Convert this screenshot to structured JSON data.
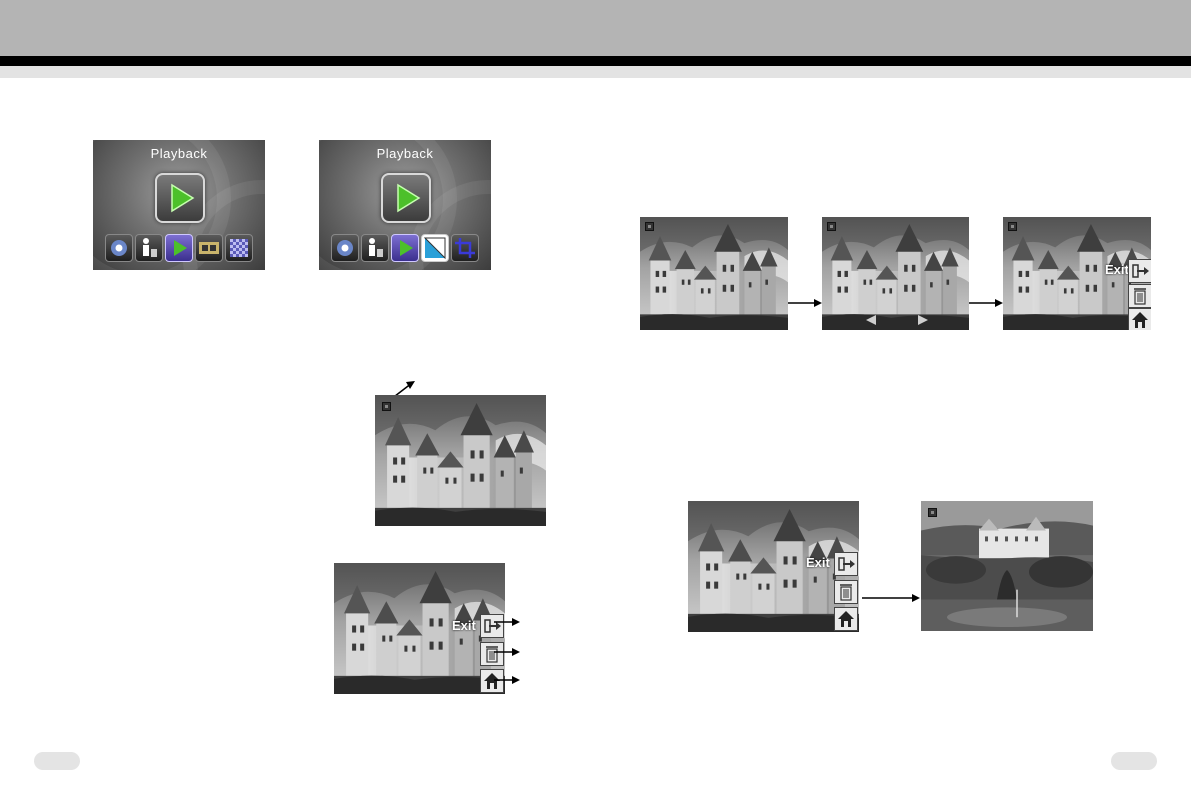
{
  "menu_screens": [
    {
      "title": "Playback",
      "icons": [
        "camera-icon",
        "person-trash-icon",
        "play-icon",
        "film-strip-icon",
        "mosaic-icon"
      ]
    },
    {
      "title": "Playback",
      "icons": [
        "camera-icon",
        "person-trash-icon",
        "play-icon",
        "rotate-icon",
        "crop-icon"
      ]
    }
  ],
  "exit_menu": {
    "exit_label": "Exit",
    "buttons": [
      "exit-icon",
      "delete-icon",
      "home-icon"
    ]
  },
  "colors": {
    "header_gray": "#b4b4b4",
    "header_black": "#000000",
    "selected_icon": "#5a4bc2",
    "play_green": "#4cc02a"
  }
}
